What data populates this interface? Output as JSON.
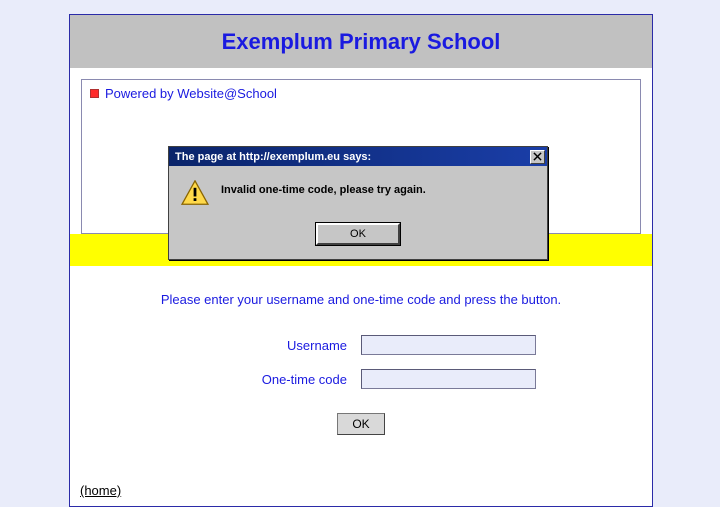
{
  "header": {
    "title": "Exemplum Primary School"
  },
  "powered": {
    "label": "Powered by Website@School"
  },
  "instructions": "Please enter your username and one-time code and press the button.",
  "form": {
    "username_label": "Username",
    "username_value": "",
    "code_label": "One-time code",
    "code_value": "",
    "submit_label": "OK"
  },
  "home_link": "(home)",
  "dialog": {
    "title": "The page at http://exemplum.eu says:",
    "message": "Invalid one-time code, please try again.",
    "ok_label": "OK",
    "close_icon": "close-icon",
    "warn_icon": "warning-icon"
  },
  "colors": {
    "page_bg": "#e9ecfa",
    "accent_blue": "#1a1ae0",
    "yellow": "#ffff00",
    "gray_header": "#c1c1c1",
    "dialog_title_from": "#0a246a",
    "dialog_title_to": "#1a3ea8"
  }
}
